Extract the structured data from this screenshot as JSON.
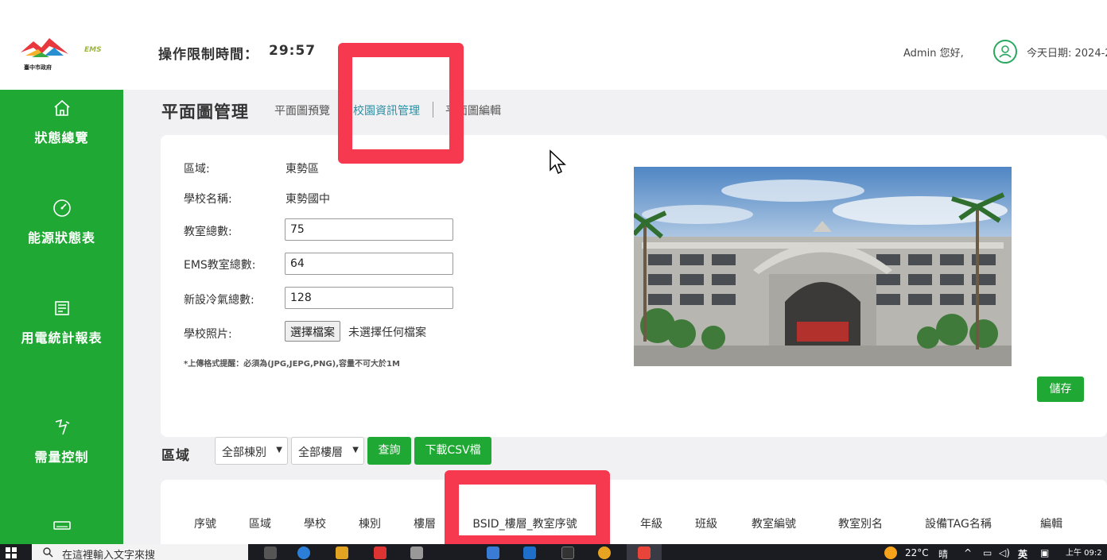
{
  "header": {
    "timer_label": "操作限制時間：",
    "timer_value": "29:57",
    "greeting": "Admin 您好,",
    "date": "今天日期: 2024-2",
    "ems_logo": "EMS",
    "gov_logo_text": "臺中市政府"
  },
  "sidebar": {
    "items": [
      {
        "label": "狀態總覽",
        "icon": "home-icon"
      },
      {
        "label": "能源狀態表",
        "icon": "gauge-icon"
      },
      {
        "label": "用電統計報表",
        "icon": "report-icon"
      },
      {
        "label": "需量控制",
        "icon": "demand-icon"
      },
      {
        "label": "",
        "icon": "air-conditioner-icon"
      }
    ]
  },
  "page": {
    "title": "平面圖管理",
    "tabs": [
      {
        "label": "平面圖預覽"
      },
      {
        "label": "校園資訊管理"
      },
      {
        "label": "平面圖編輯"
      }
    ]
  },
  "form": {
    "region_label": "區域:",
    "region_value": "東勢區",
    "school_label": "學校名稱:",
    "school_value": "東勢國中",
    "classroom_total_label": "教室總數:",
    "classroom_total_value": "75",
    "ems_classroom_label": "EMS教室總數:",
    "ems_classroom_value": "64",
    "new_ac_label": "新設冷氣總數:",
    "new_ac_value": "128",
    "photo_label": "學校照片:",
    "file_button": "選擇檔案",
    "file_none": "未選擇任何檔案",
    "hint": "*上傳格式提醒：必須為(JPG,JEPG,PNG),容量不可大於1M",
    "save_button": "儲存"
  },
  "filter": {
    "label": "區域",
    "building_select": "全部棟別",
    "floor_select": "全部樓層",
    "query_button": "查詢",
    "download_button": "下載CSV檔"
  },
  "table": {
    "headers": [
      "序號",
      "區域",
      "學校",
      "棟別",
      "樓層",
      "BSID_樓層_教室序號",
      "年級",
      "班級",
      "教室編號",
      "教室別名",
      "設備TAG名稱",
      "編輯"
    ]
  },
  "taskbar": {
    "search_placeholder": "在這裡輸入文字來搜",
    "temperature": "22°C",
    "weather": "晴",
    "ime": "英",
    "time": "上午 09:2"
  },
  "colors": {
    "sidebar_green": "#1fa833",
    "annotation_red": "#f6394f",
    "active_tab": "#2a8fa3"
  }
}
